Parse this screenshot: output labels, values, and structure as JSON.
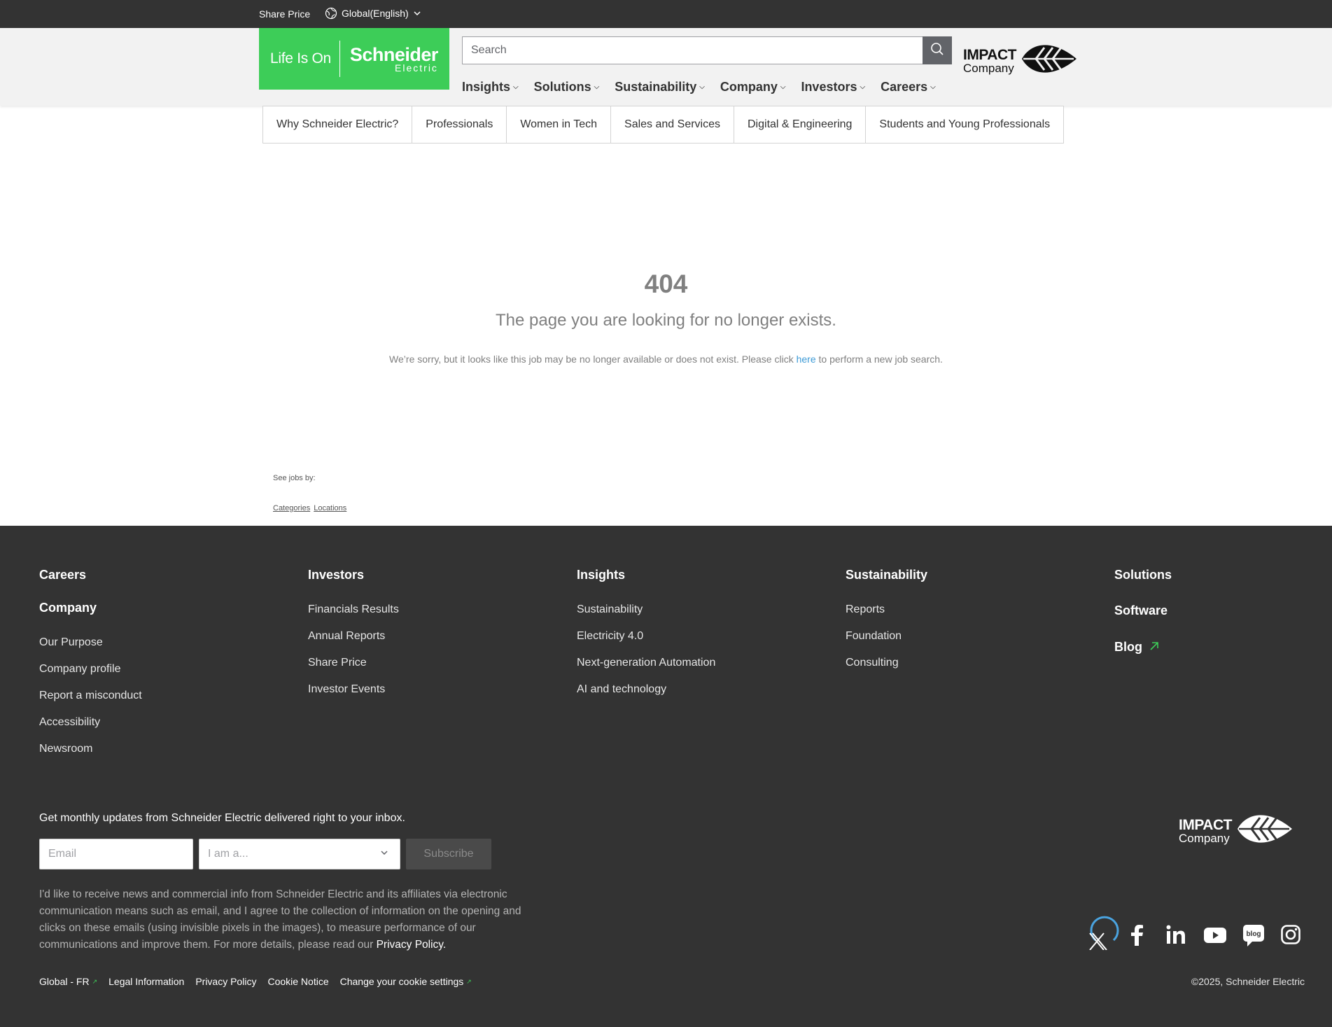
{
  "topbar": {
    "share_price": "Share Price",
    "language": "Global(English)"
  },
  "header": {
    "logo_life_is_on": "Life Is On",
    "logo_brand": "Schneider",
    "logo_brand_sub": "Electric",
    "search_placeholder": "Search",
    "impact_line1": "IMPACT",
    "impact_line2": "Company",
    "nav": [
      {
        "label": "Insights"
      },
      {
        "label": "Solutions"
      },
      {
        "label": "Sustainability"
      },
      {
        "label": "Company"
      },
      {
        "label": "Investors"
      },
      {
        "label": "Careers"
      }
    ]
  },
  "subnav": [
    {
      "label": "Why Schneider Electric?"
    },
    {
      "label": "Professionals"
    },
    {
      "label": "Women in Tech"
    },
    {
      "label": "Sales and Services"
    },
    {
      "label": "Digital & Engineering"
    },
    {
      "label": "Students and Young Professionals"
    }
  ],
  "error": {
    "code": "404",
    "message": "The page you are looking for no longer exists.",
    "desc_before": "We’re sorry, but it looks like this job may be no longer available or does not exist. Please click ",
    "desc_link": "here",
    "desc_after": " to perform a new job search."
  },
  "see_jobs": {
    "label": "See jobs by:",
    "categories": "Categories",
    "locations": "Locations"
  },
  "footer": {
    "col1": {
      "heading": "Careers",
      "heading2": "Company",
      "links": [
        "Our Purpose",
        "Company profile",
        "Report a misconduct",
        "Accessibility",
        "Newsroom"
      ]
    },
    "col2": {
      "heading": "Investors",
      "links": [
        "Financials Results",
        "Annual Reports",
        "Share Price",
        "Investor Events"
      ]
    },
    "col3": {
      "heading": "Insights",
      "links": [
        "Sustainability",
        "Electricity 4.0",
        "Next-generation Automation",
        "AI and technology"
      ]
    },
    "col4": {
      "heading": "Sustainability",
      "links": [
        "Reports",
        "Foundation",
        "Consulting"
      ]
    },
    "col5": {
      "heading": "Solutions",
      "software": "Software",
      "blog": "Blog"
    },
    "newsletter": {
      "heading": "Get monthly updates from Schneider Electric delivered right to your inbox.",
      "email_placeholder": "Email",
      "role_placeholder": "I am a...",
      "subscribe": "Subscribe",
      "consent": "I'd like to receive news and commercial info from Schneider Electric and its affiliates via electronic communication means such as email, and I agree to the collection of information on the opening and clicks on these emails (using invisible pixels in the images), to measure performance of our communications and improve them. For more details, please read our ",
      "consent_link": "Privacy Policy."
    },
    "impact_line1": "IMPACT",
    "impact_line2": "Company",
    "social_icons": [
      "x-icon",
      "facebook-icon",
      "linkedin-icon",
      "youtube-icon",
      "blog-icon",
      "instagram-icon"
    ],
    "blog_badge": "blog",
    "bottom_links": [
      "Global - FR",
      "Legal Information",
      "Privacy Policy",
      "Cookie Notice",
      "Change your cookie settings"
    ],
    "copyright": "©2025, Schneider Electric"
  },
  "colors": {
    "brand_green": "#3dcd58",
    "dark_bg": "#333333",
    "link_blue": "#3c9ad6"
  }
}
